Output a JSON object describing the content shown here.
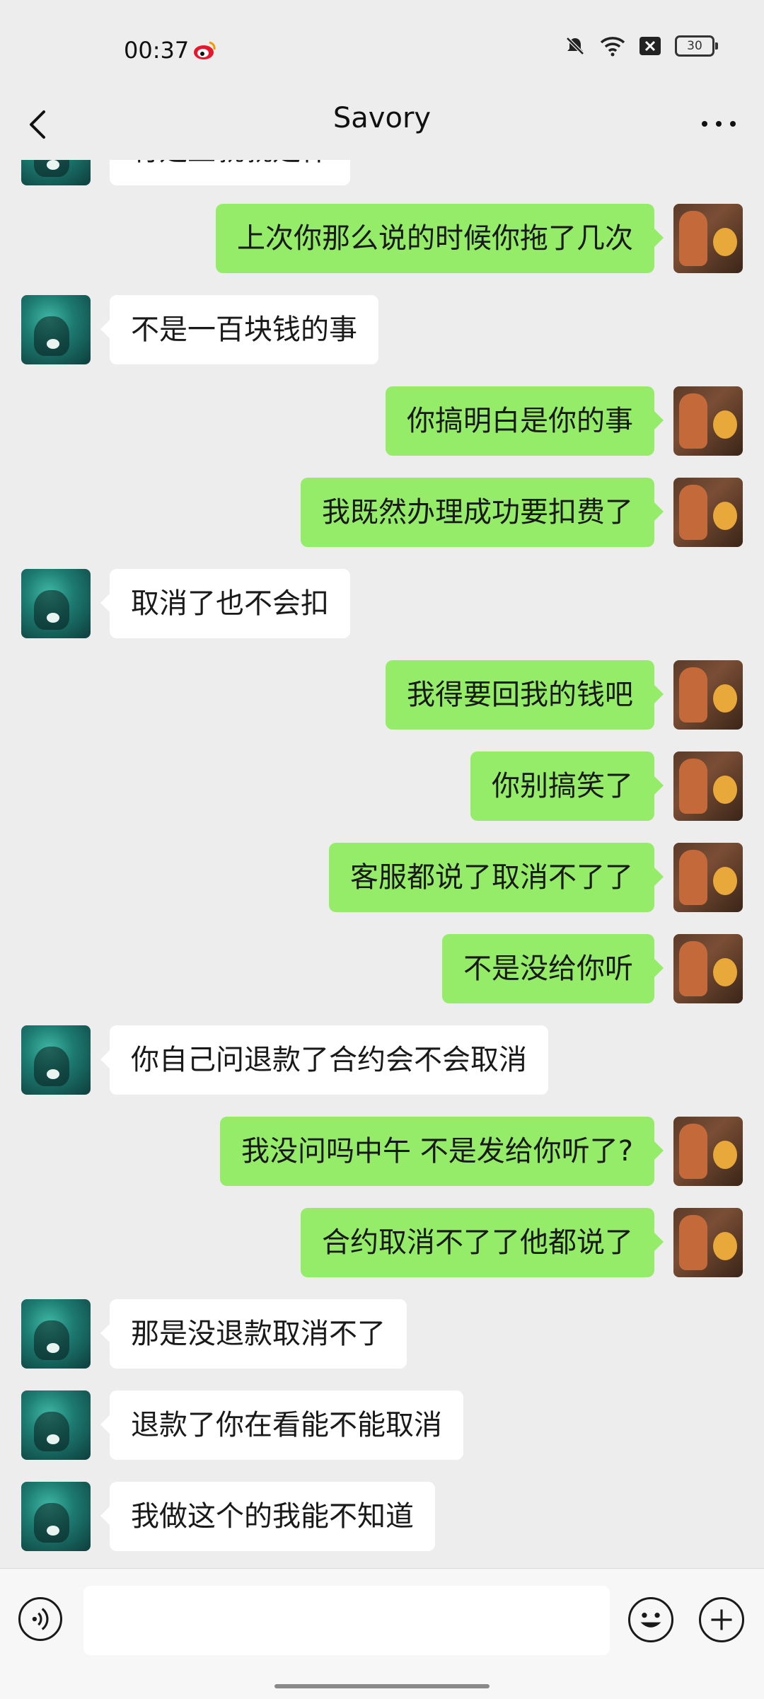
{
  "status_bar": {
    "time": "00:37",
    "battery": "30",
    "icons": [
      "weibo-icon",
      "mute-icon",
      "wifi-icon",
      "sim-disabled-icon",
      "battery-icon"
    ]
  },
  "header": {
    "title": "Savory",
    "back_icon": "chevron-left-icon",
    "more_icon": "more-dots-icon"
  },
  "messages": [
    {
      "from": "peer",
      "text": "有是上就就是什"
    },
    {
      "from": "me",
      "text": "上次你那么说的时候你拖了几次"
    },
    {
      "from": "peer",
      "text": "不是一百块钱的事"
    },
    {
      "from": "me",
      "text": "你搞明白是你的事"
    },
    {
      "from": "me",
      "text": "我既然办理成功要扣费了"
    },
    {
      "from": "peer",
      "text": "取消了也不会扣"
    },
    {
      "from": "me",
      "text": "我得要回我的钱吧"
    },
    {
      "from": "me",
      "text": "你别搞笑了"
    },
    {
      "from": "me",
      "text": "客服都说了取消不了了"
    },
    {
      "from": "me",
      "text": "不是没给你听"
    },
    {
      "from": "peer",
      "text": "你自己问退款了合约会不会取消"
    },
    {
      "from": "me",
      "text": "我没问吗中午 不是发给你听了?"
    },
    {
      "from": "me",
      "text": "合约取消不了了他都说了"
    },
    {
      "from": "peer",
      "text": "那是没退款取消不了"
    },
    {
      "from": "peer",
      "text": "退款了你在看能不能取消"
    },
    {
      "from": "peer",
      "text": "我做这个的我能不知道"
    }
  ],
  "input_bar": {
    "text_value": "",
    "icons": [
      "voice-icon",
      "emoji-icon",
      "plus-icon"
    ]
  },
  "colors": {
    "background": "#ededed",
    "my_bubble": "#95ec69",
    "peer_bubble": "#ffffff"
  }
}
